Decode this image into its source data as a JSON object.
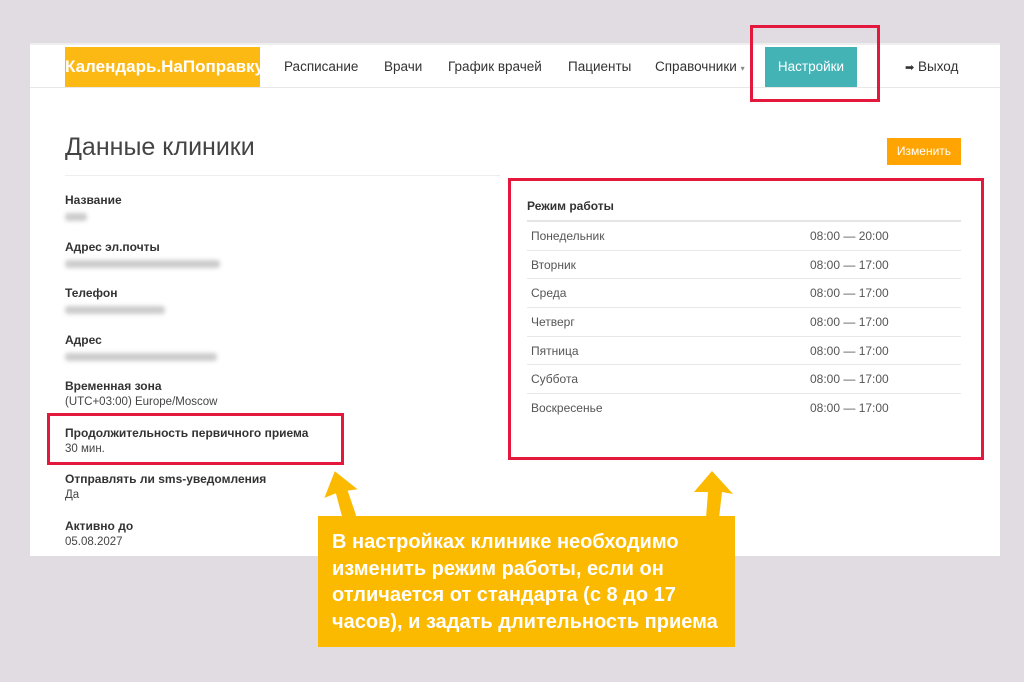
{
  "nav": {
    "logo": "Календарь.НаПоправку",
    "items": [
      "Расписание",
      "Врачи",
      "График врачей",
      "Пациенты",
      "Справочники"
    ],
    "settings": "Настройки",
    "logout": "Выход"
  },
  "page": {
    "title": "Данные клиники",
    "edit_label": "Изменить"
  },
  "fields": [
    {
      "label": "Название",
      "value": null
    },
    {
      "label": "Адрес эл.почты",
      "value": null
    },
    {
      "label": "Телефон",
      "value": null
    },
    {
      "label": "Адрес",
      "value": null
    },
    {
      "label": "Временная зона",
      "value": "(UTC+03:00) Europe/Moscow"
    },
    {
      "label": "Продолжительность первичного приема",
      "value": "30 мин."
    },
    {
      "label": "Отправлять ли sms-уведомления",
      "value": "Да"
    },
    {
      "label": "Активно до",
      "value": "05.08.2027"
    }
  ],
  "hours": {
    "title": "Режим работы",
    "rows": [
      {
        "day": "Понедельник",
        "time": "08:00 — 20:00"
      },
      {
        "day": "Вторник",
        "time": "08:00 — 17:00"
      },
      {
        "day": "Среда",
        "time": "08:00 — 17:00"
      },
      {
        "day": "Четверг",
        "time": "08:00 — 17:00"
      },
      {
        "day": "Пятница",
        "time": "08:00 — 17:00"
      },
      {
        "day": "Суббота",
        "time": "08:00 — 17:00"
      },
      {
        "day": "Воскресенье",
        "time": "08:00 — 17:00"
      }
    ]
  },
  "callout": "В настройках клинике необходимо изменить режим работы, если он отличается от стандарта (с 8 до 17 часов), и задать длительность приема",
  "colors": {
    "logo": "#fdb913",
    "settings": "#43b3b6",
    "highlight": "#e4183c",
    "callout": "#fbb900",
    "edit": "#ffa400"
  }
}
